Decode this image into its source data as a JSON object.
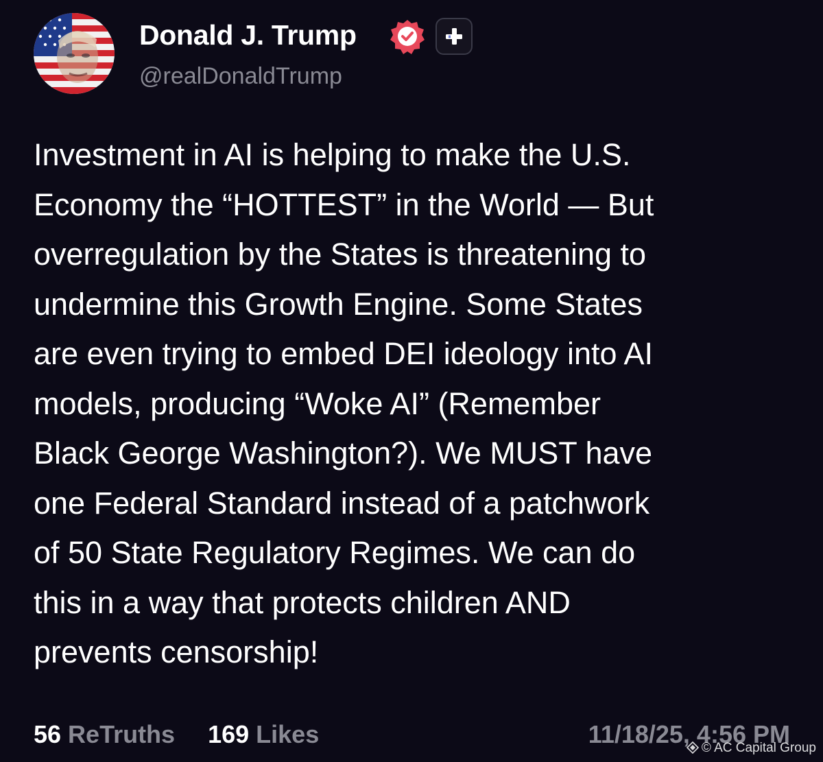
{
  "author": {
    "display_name": "Donald J. Trump",
    "handle": "@realDonaldTrump",
    "verified_badge_color": "#e8485a",
    "avatar_icon": "flag-portrait-avatar",
    "follow_icon": "plus-icon"
  },
  "post": {
    "lines": [
      "Investment in AI is helping to make the U.S.",
      "Economy the “HOTTEST” in the World — But",
      "overregulation by the States is threatening to",
      "undermine this Growth Engine. Some States",
      "are even trying to embed DEI ideology into AI",
      "models, producing “Woke AI” (Remember",
      "Black George Washington?). We MUST have",
      "one Federal Standard instead of a patchwork",
      "of 50 State Regulatory Regimes. We can do",
      "this in a way that protects children AND",
      "prevents censorship!"
    ]
  },
  "stats": {
    "retruths_count": "56",
    "retruths_label": "ReTruths",
    "likes_count": "169",
    "likes_label": "Likes"
  },
  "timestamp": "11/18/25, 4:56 PM",
  "watermark": {
    "text": "© AC Capital Group",
    "icon": "binance-diamond-icon"
  },
  "colors": {
    "background": "#0c0a17",
    "text": "#ffffff",
    "muted": "#8a8a94"
  }
}
